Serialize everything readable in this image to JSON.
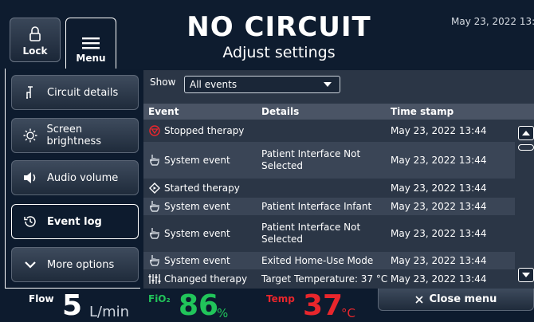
{
  "header": {
    "lock_label": "Lock",
    "menu_label": "Menu",
    "title": "NO CIRCUIT",
    "subtitle": "Adjust settings",
    "datetime": "May 23, 2022 13:44"
  },
  "sidebar": {
    "items": [
      {
        "label": "Circuit details",
        "icon": "circuit-icon",
        "selected": false
      },
      {
        "label": "Screen brightness",
        "icon": "brightness-icon",
        "selected": false
      },
      {
        "label": "Audio volume",
        "icon": "speaker-icon",
        "selected": false
      },
      {
        "label": "Event log",
        "icon": "history-icon",
        "selected": true
      },
      {
        "label": "More options",
        "icon": "chevron-down-icon",
        "selected": false
      }
    ]
  },
  "event_log": {
    "show_label": "Show",
    "filter_value": "All events",
    "columns": [
      "Event",
      "Details",
      "Time stamp"
    ],
    "rows": [
      {
        "icon": "stop-icon",
        "event": "Stopped therapy",
        "details": "",
        "timestamp": "May 23, 2022 13:44"
      },
      {
        "icon": "hand-icon",
        "event": "System event",
        "details": "Patient Interface Not Selected",
        "timestamp": "May 23, 2022 13:44"
      },
      {
        "icon": "diamond-icon",
        "event": "Started therapy",
        "details": "",
        "timestamp": "May 23, 2022 13:44"
      },
      {
        "icon": "hand-icon",
        "event": "System event",
        "details": "Patient Interface Infant",
        "timestamp": "May 23, 2022 13:44"
      },
      {
        "icon": "hand-icon",
        "event": "System event",
        "details": "Patient Interface Not Selected",
        "timestamp": "May 23, 2022 13:44"
      },
      {
        "icon": "hand-icon",
        "event": "System event",
        "details": "Exited Home-Use Mode",
        "timestamp": "May 23, 2022 13:44"
      },
      {
        "icon": "adjust-icon",
        "event": "Changed therapy",
        "details": "Target Temperature: 37 °C",
        "timestamp": "May 23, 2022 13:44"
      }
    ]
  },
  "status": {
    "flow_label": "Flow",
    "flow_value": "5",
    "flow_unit": "L/min",
    "fio2_label": "FiO₂",
    "fio2_value": "86",
    "fio2_unit": "%",
    "temp_label": "Temp",
    "temp_value": "37",
    "temp_unit": "°C",
    "close_label": "Close menu"
  },
  "colors": {
    "background": "#0d1b2e",
    "fio2": "#21c45a",
    "temp": "#e8262c",
    "stop_icon": "#e8262c"
  }
}
